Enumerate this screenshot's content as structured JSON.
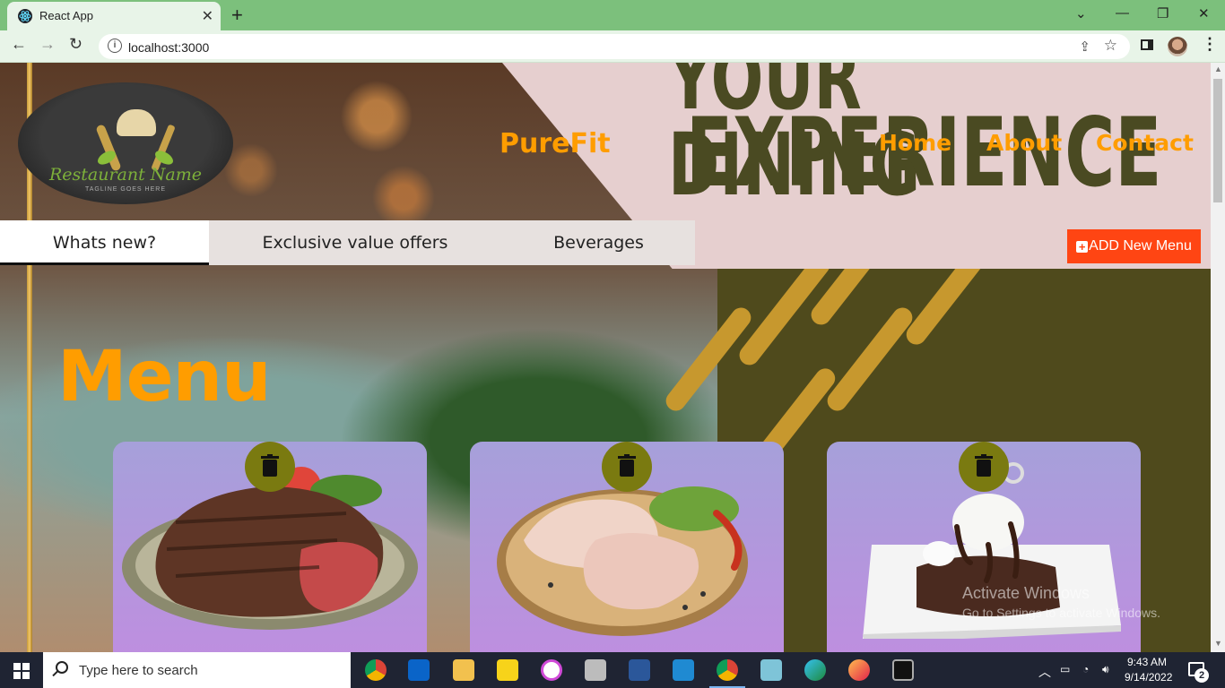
{
  "browser": {
    "tab_title": "React App",
    "tab_close": "✕",
    "new_tab": "+",
    "url": "localhost:3000",
    "window_controls": [
      "⌄",
      "—",
      "❐",
      "✕"
    ]
  },
  "page": {
    "header": {
      "brand": "PureFit",
      "nav": [
        "Home",
        "About",
        "Contact"
      ],
      "logo": {
        "name": "Restaurant Name",
        "tagline": "TAGLINE GOES HERE"
      }
    },
    "poster": {
      "line1": "YOUR DINING",
      "line2": "EXPERIENCE"
    },
    "categories": [
      {
        "label": "Whats new?",
        "active": true
      },
      {
        "label": "Exclusive value offers",
        "active": false
      },
      {
        "label": "Beverages",
        "active": false
      }
    ],
    "add_button": {
      "icon": "plus-square-icon",
      "label": "ADD New Menu"
    },
    "menu_title": "Menu",
    "cards": [
      {
        "image": "steak-image",
        "delete_icon": "trash-icon"
      },
      {
        "image": "raw-chicken-image",
        "delete_icon": "trash-icon"
      },
      {
        "image": "chocolate-cake-image",
        "delete_icon": "trash-icon"
      }
    ],
    "watermark": {
      "line1": "Activate Windows",
      "line2": "Go to Settings to activate Windows."
    }
  },
  "taskbar": {
    "search_placeholder": "Type here to search",
    "apps": [
      "chrome-icon",
      "outlook-icon",
      "file-explorer-icon",
      "sticky-notes-icon",
      "itunes-icon",
      "calculator-icon",
      "word-icon",
      "vscode-icon",
      "chrome-profile-icon",
      "snip-icon",
      "edge-icon",
      "firefox-icon",
      "terminal-icon"
    ],
    "time": "9:43 AM",
    "date": "9/14/2022",
    "notifications": "2"
  },
  "colors": {
    "accent_orange": "#ff9d00",
    "add_button": "#ff4513",
    "delete_button": "#7a7a10",
    "tab_green": "#7cc07c"
  }
}
